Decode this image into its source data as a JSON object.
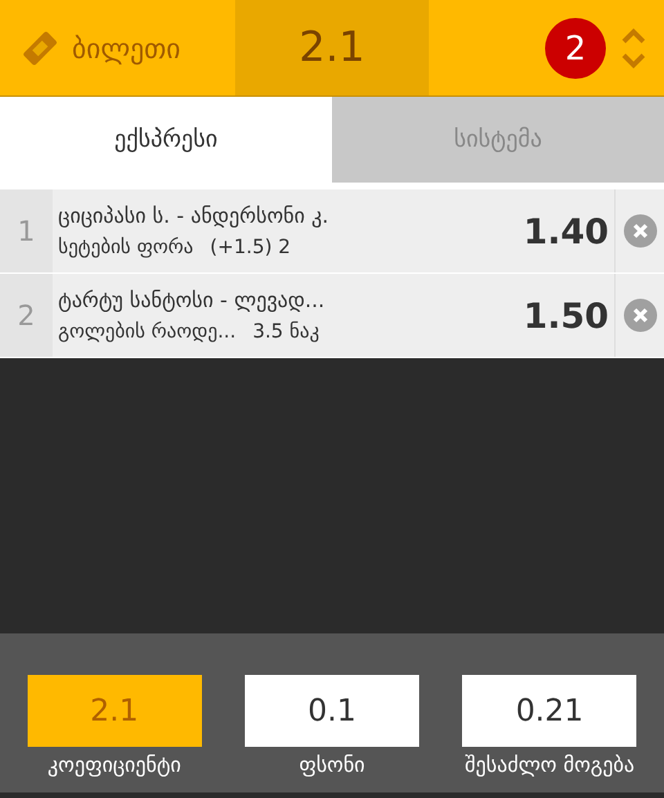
{
  "header": {
    "title": "ბილეთი",
    "total_odds": "2.1",
    "count": "2"
  },
  "tabs": [
    {
      "label": "ექსპრესი",
      "selected": true
    },
    {
      "label": "სისტემა",
      "selected": false
    }
  ],
  "bets": [
    {
      "number": "1",
      "event": "ციციპასი ს. - ანდერსონი კ.",
      "market": "სეტების ფორა",
      "pick": "(+1.5) 2",
      "odds": "1.40"
    },
    {
      "number": "2",
      "event": "ტარტუ სანტოსი - ლევად...",
      "market": "გოლების რაოდე...",
      "pick": "3.5 ნაკ",
      "odds": "1.50"
    }
  ],
  "summary": [
    {
      "value": "2.1",
      "label": "კოეფიციენტი",
      "selected": true
    },
    {
      "value": "0.1",
      "label": "ფსონი",
      "selected": false
    },
    {
      "value": "0.21",
      "label": "შესაძლო მოგება",
      "selected": false
    }
  ]
}
